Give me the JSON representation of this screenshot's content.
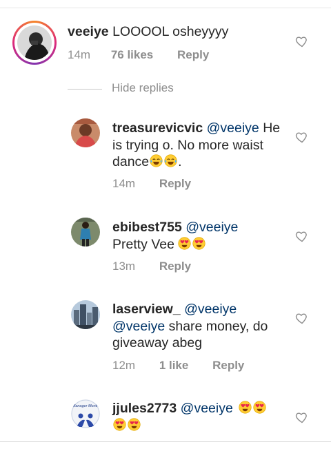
{
  "comments": [
    {
      "username": "veeiye",
      "text": "LOOOOL osheyyyy",
      "time": "14m",
      "likes": "76 likes",
      "reply": "Reply"
    },
    {
      "username": "treasurevicvic",
      "mention": "@veeiye",
      "text_line1": "He",
      "text_line2": "is trying o. No more waist",
      "text_line3_prefix": "dance",
      "text_line3_suffix": ".",
      "emojis": [
        "face-with-tears-of-joy",
        "face-with-tears-of-joy"
      ],
      "time": "14m",
      "reply": "Reply"
    },
    {
      "username": "ebibest755",
      "mention": "@veeiye",
      "text": "Pretty Vee",
      "emojis": [
        "smiling-face-with-heart-eyes",
        "smiling-face-with-heart-eyes"
      ],
      "time": "13m",
      "reply": "Reply"
    },
    {
      "username": "laserview_",
      "mention": "@veeiye",
      "mention2": "@veeiye",
      "text_line2": "share money, do",
      "text_line3": "giveaway abeg",
      "time": "12m",
      "likes": "1 like",
      "reply": "Reply"
    },
    {
      "username": "jjules2773",
      "mention": "@veeiye",
      "emojis": [
        "smiling-face-with-heart-eyes",
        "smiling-face-with-heart-eyes",
        "smiling-face-with-heart-eyes",
        "smiling-face-with-heart-eyes"
      ]
    }
  ],
  "hide_replies": "Hide replies",
  "avatar_texts": {
    "jjules": "Manager Month"
  },
  "colors": {
    "text": "#262626",
    "muted": "#8e8e8e",
    "mention": "#003569",
    "story_ring": [
      "#f58529",
      "#dd2a7b",
      "#8134af"
    ]
  },
  "icons": [
    "heart-outline-icon",
    "avatar-image"
  ]
}
